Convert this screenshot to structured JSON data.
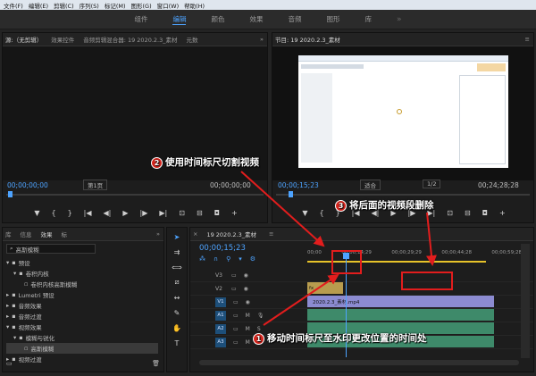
{
  "menu": [
    "文件(F)",
    "编辑(E)",
    "剪辑(C)",
    "序列(S)",
    "标记(M)",
    "图形(G)",
    "窗口(W)",
    "帮助(H)"
  ],
  "workspaces": [
    "组件",
    "编辑",
    "颜色",
    "效果",
    "音频",
    "图形",
    "库"
  ],
  "source": {
    "tabs": [
      "源:（无剪辑）",
      "效果控件",
      "音频剪辑混合器: 19 2020.2.3_素材",
      "元数"
    ],
    "tc_left": "00;00;00;00",
    "page": "第1页",
    "tc_right": "00;00;00;00"
  },
  "program": {
    "tab": "节目: 19 2020.2.3_素材",
    "tc_left": "00;00;15;23",
    "fit": "适合",
    "ratio": "1/2",
    "tc_right": "00;24;28;28"
  },
  "project": {
    "tabs": [
      "库",
      "信息",
      "效果",
      "标"
    ],
    "search": "高斯模糊",
    "tree": [
      "预设",
      "卷积内核",
      "卷积内核高斯模糊",
      "Lumetri 预设",
      "音频效果",
      "音频过渡",
      "视频效果",
      "模糊与锐化",
      "高斯模糊",
      "视频过渡"
    ]
  },
  "timeline": {
    "tab": "19 2020.2.3_素材",
    "tc": "00;00;15;23",
    "ruler": [
      "00;00",
      "00;00;14;29",
      "00;00;29;29",
      "00;00;44;28",
      "00;00;59;28"
    ],
    "tracks": [
      "V3",
      "V2",
      "V1",
      "A1",
      "A2",
      "A3"
    ],
    "clip_fx": "fx",
    "clip_v1": "2020.2.3_素材.mp4"
  },
  "callouts": {
    "c1": {
      "num": "1",
      "text": "移动时间标尺至水印更改位置的时间处"
    },
    "c2": {
      "num": "2",
      "text": "使用时间标尺切割视频"
    },
    "c3": {
      "num": "3",
      "text": "将后面的视频段删除"
    }
  },
  "colors": {
    "accent": "#4da3ff",
    "annotation": "#d9251d"
  }
}
